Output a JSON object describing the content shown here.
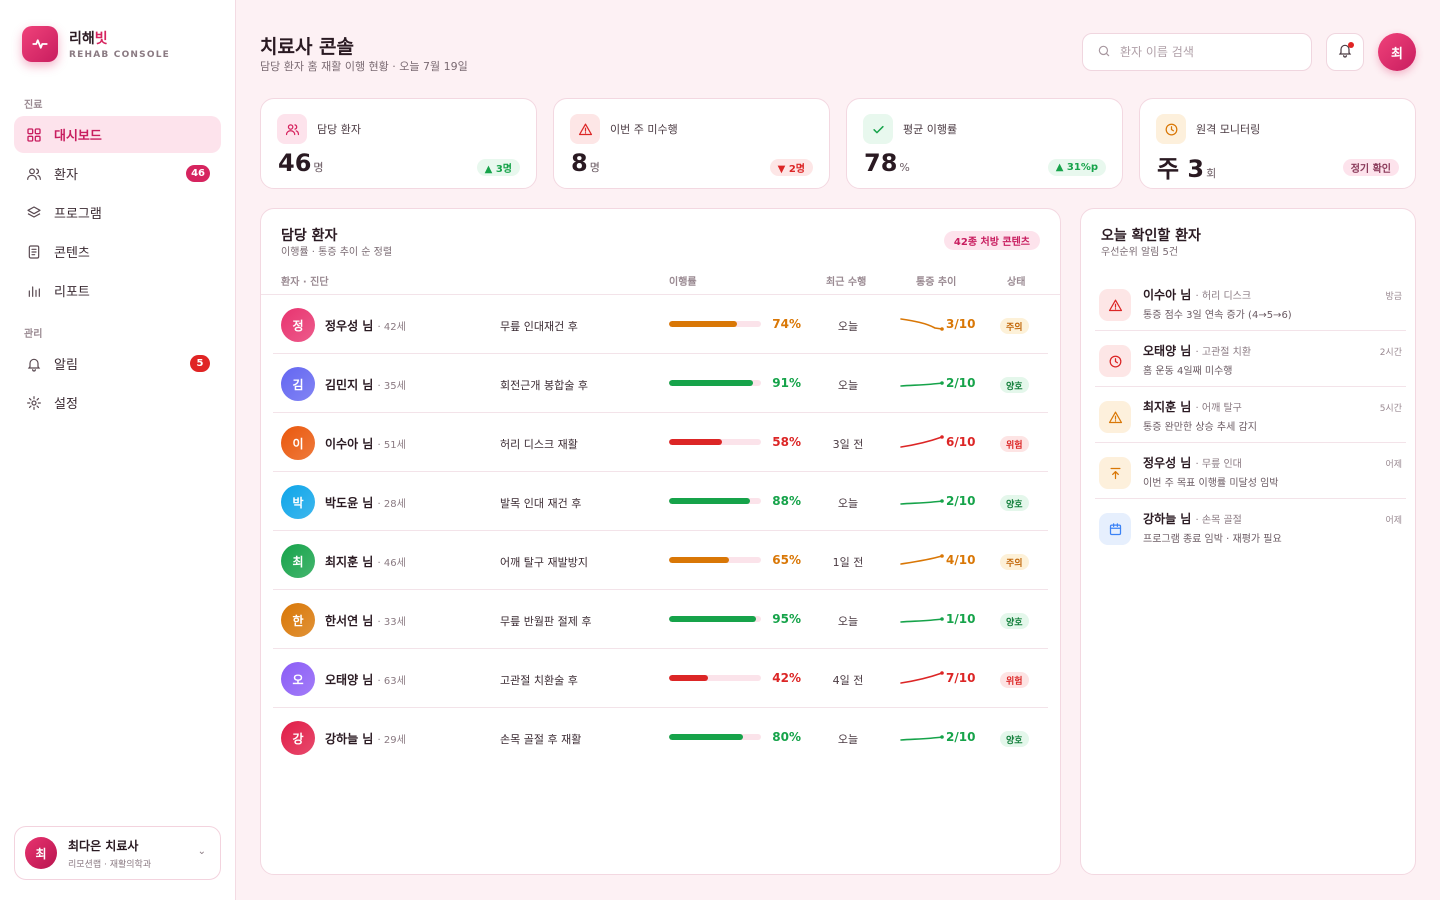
{
  "brand": {
    "name": "리해",
    "name_accent": "빗",
    "sub": "REHAB CONSOLE"
  },
  "nav": {
    "section_care": "진료",
    "section_admin": "관리",
    "items": [
      {
        "label": "대시보드",
        "icon": "dashboard-icon",
        "active": true
      },
      {
        "label": "환자",
        "icon": "users-icon",
        "badge": "46"
      },
      {
        "label": "프로그램",
        "icon": "layers-icon"
      },
      {
        "label": "콘텐츠",
        "icon": "document-icon"
      },
      {
        "label": "리포트",
        "icon": "chart-icon"
      },
      {
        "label": "알림",
        "icon": "bell-icon",
        "badge": "5"
      },
      {
        "label": "설정",
        "icon": "gear-icon"
      }
    ]
  },
  "user": {
    "avatar": "최",
    "name": "최다은 치료사",
    "org": "리모션랩 · 재활의학과"
  },
  "header": {
    "title": "치료사 콘솔",
    "subtitle": "담당 환자 홈 재활 이행 현황 · 오늘 7월 19일",
    "search_placeholder": "환자 이름 검색",
    "avatar": "최"
  },
  "stats": [
    {
      "label": "담당 환자",
      "value": "46",
      "unit": "명",
      "chip": "▲ 3명",
      "tone": "pink",
      "icon": "users-icon"
    },
    {
      "label": "이번 주 미수행",
      "value": "8",
      "unit": "명",
      "chip": "▼ 2명",
      "tone": "red",
      "icon": "warning-icon"
    },
    {
      "label": "평균 이행률",
      "value": "78",
      "unit": "%",
      "chip": "▲ 31%p",
      "tone": "green",
      "icon": "check-icon"
    },
    {
      "label": "원격 모니터링",
      "value": "주 3",
      "unit": "회",
      "chip": "정기 확인",
      "tone": "amber",
      "icon": "clock-icon"
    }
  ],
  "patients_panel": {
    "title": "담당 환자",
    "subtitle": "이행률 · 통증 추이 순 정렬",
    "badge": "42종 처방 콘텐츠",
    "columns": {
      "patient": "환자 · 진단",
      "adherence": "이행률",
      "last": "최근 수행",
      "pain": "통증 추이",
      "status": "상태"
    }
  },
  "patients": [
    {
      "initial": "정",
      "name": "정우성 님",
      "age": "· 42세",
      "diagnosis": "무릎 인대재건 후",
      "adherence": 74,
      "adherence_label": "74%",
      "last": "오늘",
      "pain": "3/10",
      "trend": "down",
      "status": "주의",
      "color": "#e8336f",
      "tone": "amber"
    },
    {
      "initial": "김",
      "name": "김민지 님",
      "age": "· 35세",
      "diagnosis": "회전근개 봉합술 후",
      "adherence": 91,
      "adherence_label": "91%",
      "last": "오늘",
      "pain": "2/10",
      "trend": "flat",
      "status": "양호",
      "color": "#6366f1",
      "tone": "green"
    },
    {
      "initial": "이",
      "name": "이수아 님",
      "age": "· 51세",
      "diagnosis": "허리 디스크 재활",
      "adherence": 58,
      "adherence_label": "58%",
      "last": "3일 전",
      "pain": "6/10",
      "trend": "up",
      "status": "위험",
      "color": "#ea580c",
      "tone": "red"
    },
    {
      "initial": "박",
      "name": "박도윤 님",
      "age": "· 28세",
      "diagnosis": "발목 인대 재건 후",
      "adherence": 88,
      "adherence_label": "88%",
      "last": "오늘",
      "pain": "2/10",
      "trend": "flat",
      "status": "양호",
      "color": "#0ea5e9",
      "tone": "green"
    },
    {
      "initial": "최",
      "name": "최지훈 님",
      "age": "· 46세",
      "diagnosis": "어깨 탈구 재발방지",
      "adherence": 65,
      "adherence_label": "65%",
      "last": "1일 전",
      "pain": "4/10",
      "trend": "rise",
      "status": "주의",
      "color": "#16a34a",
      "tone": "amber"
    },
    {
      "initial": "한",
      "name": "한서연 님",
      "age": "· 33세",
      "diagnosis": "무릎 반월판 절제 후",
      "adherence": 95,
      "adherence_label": "95%",
      "last": "오늘",
      "pain": "1/10",
      "trend": "flat",
      "status": "양호",
      "color": "#d97706",
      "tone": "green"
    },
    {
      "initial": "오",
      "name": "오태양 님",
      "age": "· 63세",
      "diagnosis": "고관절 치환술 후",
      "adherence": 42,
      "adherence_label": "42%",
      "last": "4일 전",
      "pain": "7/10",
      "trend": "up",
      "status": "위험",
      "color": "#8b5cf6",
      "tone": "red"
    },
    {
      "initial": "강",
      "name": "강하늘 님",
      "age": "· 29세",
      "diagnosis": "손목 골절 후 재활",
      "adherence": 80,
      "adherence_label": "80%",
      "last": "오늘",
      "pain": "2/10",
      "trend": "flat",
      "status": "양호",
      "color": "#e11d48",
      "tone": "green"
    }
  ],
  "alerts_panel": {
    "title": "오늘 확인할 환자",
    "subtitle": "우선순위 알림 5건"
  },
  "alerts": [
    {
      "name": "이수아 님",
      "sub": "· 허리 디스크",
      "desc": "통증 점수 3일 연속 증가 (4→5→6)",
      "time": "방금",
      "icon": "warning-icon",
      "tone": "red"
    },
    {
      "name": "오태양 님",
      "sub": "· 고관절 치환",
      "desc": "홈 운동 4일째 미수행",
      "time": "2시간",
      "icon": "clock-icon",
      "tone": "red"
    },
    {
      "name": "최지훈 님",
      "sub": "· 어깨 탈구",
      "desc": "통증 완만한 상승 추세 감지",
      "time": "5시간",
      "icon": "warning-icon",
      "tone": "amber"
    },
    {
      "name": "정우성 님",
      "sub": "· 무릎 인대",
      "desc": "이번 주 목표 이행률 미달성 임박",
      "time": "어제",
      "icon": "arrow-up-icon",
      "tone": "amber"
    },
    {
      "name": "강하늘 님",
      "sub": "· 손목 골절",
      "desc": "프로그램 종료 임박 · 재평가 필요",
      "time": "어제",
      "icon": "calendar-icon",
      "tone": "blue"
    }
  ],
  "colors": {
    "accent": "#d6245f",
    "green": "#16a34a",
    "red": "#dc2626",
    "amber": "#d97706",
    "blue": "#3b82f6"
  }
}
